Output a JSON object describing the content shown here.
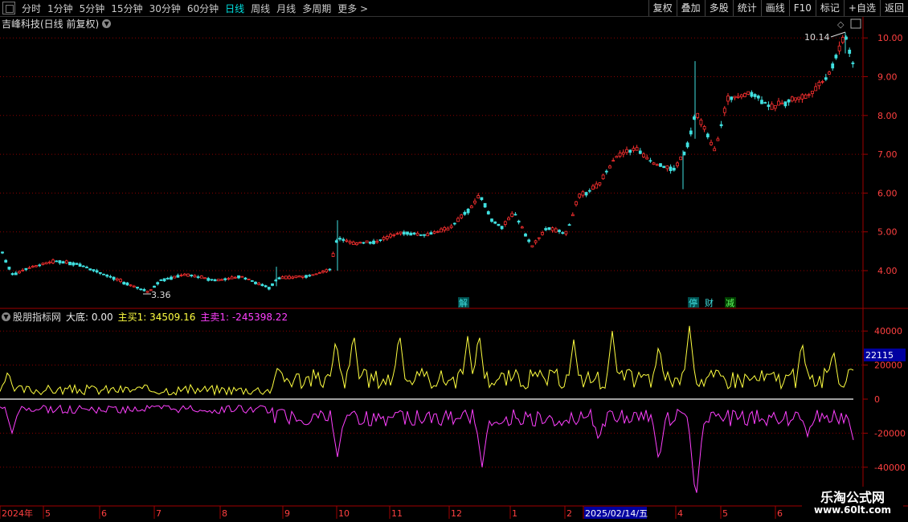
{
  "toolbar": {
    "periods": [
      "分时",
      "1分钟",
      "5分钟",
      "15分钟",
      "30分钟",
      "60分钟",
      "日线",
      "周线",
      "月线",
      "多周期",
      "更多 >"
    ],
    "active_period": "日线",
    "right_buttons": [
      "复权",
      "叠加",
      "多股",
      "统计",
      "画线",
      "F10",
      "标记",
      "+自选",
      "返回"
    ]
  },
  "stock": {
    "name": "吉峰科技(日线 前复权)"
  },
  "price_axis": {
    "ticks": [
      "10.00",
      "9.00",
      "8.00",
      "7.00",
      "6.00",
      "5.00",
      "4.00"
    ]
  },
  "annotations": {
    "high_label": "10.14",
    "low_label": "3.36"
  },
  "event_marks": [
    "解",
    "停",
    "财",
    "减"
  ],
  "indicator": {
    "name": "股朋指标网",
    "dadi_label": "大底: 0.00",
    "buy_label": "主买1: 34509.16",
    "sell_label": "主卖1: -245398.22",
    "axis_ticks": [
      "40000",
      "20000",
      "0",
      "-20000",
      "-40000"
    ],
    "current_value": "22115"
  },
  "date_axis": {
    "labels": [
      "2024年",
      "5",
      "6",
      "7",
      "8",
      "9",
      "10",
      "11",
      "12",
      "1",
      "2",
      "2025/02/14/五",
      "4",
      "5",
      "6"
    ],
    "highlight": "2025/02/14/五"
  },
  "watermark": {
    "line1": "乐淘公式网",
    "line2": "www.60lt.com"
  },
  "colors": {
    "up": "#ff3030",
    "down": "#40e0e0",
    "buy_line": "#ffff40",
    "sell_line": "#ff40ff",
    "grid": "#8b0000"
  }
}
